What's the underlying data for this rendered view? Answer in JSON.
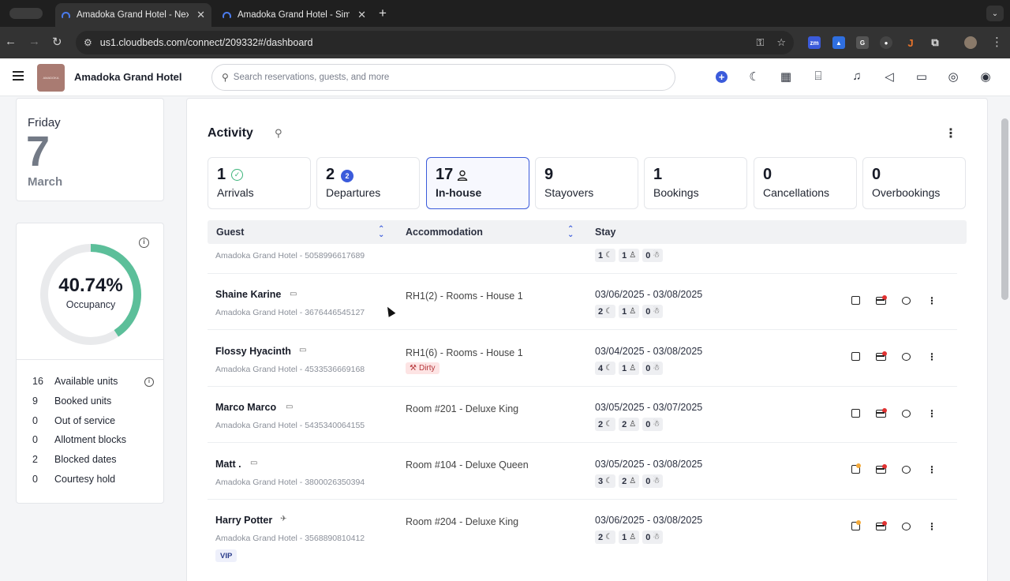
{
  "browser": {
    "tabs": [
      {
        "title": "Amadoka Grand Hotel - Next",
        "active": true
      },
      {
        "title": "Amadoka Grand Hotel - Simp",
        "active": false
      }
    ],
    "new_tab": "+",
    "url": "us1.cloudbeds.com/connect/209332#/dashboard"
  },
  "header": {
    "hotel_name": "Amadoka Grand Hotel",
    "search_placeholder": "Search reservations, guests, and more",
    "icons": [
      "add-icon",
      "moon-icon",
      "calendar-icon",
      "bed-icon",
      "bell-icon",
      "megaphone-icon",
      "inbox-icon",
      "wallet-icon",
      "user-icon"
    ]
  },
  "date_card": {
    "weekday": "Friday",
    "day": "7",
    "month": "March"
  },
  "occupancy": {
    "percent_text": "40.74%",
    "percent_value": 40.74,
    "label": "Occupancy",
    "colors": {
      "filled": "#5cbf9a",
      "track": "#e9eaec"
    },
    "stats": [
      {
        "value": "16",
        "label": "Available units"
      },
      {
        "value": "9",
        "label": "Booked units"
      },
      {
        "value": "0",
        "label": "Out of service"
      },
      {
        "value": "0",
        "label": "Allotment blocks"
      },
      {
        "value": "2",
        "label": "Blocked dates"
      },
      {
        "value": "0",
        "label": "Courtesy hold"
      }
    ]
  },
  "activity": {
    "title": "Activity",
    "tabs": [
      {
        "count": "1",
        "label": "Arrivals"
      },
      {
        "count": "2",
        "label": "Departures",
        "badge": "2"
      },
      {
        "count": "17",
        "label": "In-house"
      },
      {
        "count": "9",
        "label": "Stayovers"
      },
      {
        "count": "1",
        "label": "Bookings"
      },
      {
        "count": "0",
        "label": "Cancellations"
      },
      {
        "count": "0",
        "label": "Overbookings"
      }
    ],
    "columns": {
      "guest": "Guest",
      "accommodation": "Accommodation",
      "stay": "Stay"
    },
    "partial_row": {
      "sub": "Amadoka Grand Hotel - 5058996617689",
      "nights": "1",
      "adults": "1",
      "kids": "0"
    },
    "rows": [
      {
        "name": "Shaine Karine",
        "sub": "Amadoka Grand Hotel - 3676446545127",
        "accommodation": "RH1(2) - Rooms - House 1",
        "dates": "03/06/2025 - 03/08/2025",
        "nights": "2",
        "adults": "1",
        "kids": "0"
      },
      {
        "name": "Flossy Hyacinth",
        "sub": "Amadoka Grand Hotel - 4533536669168",
        "accommodation": "RH1(6) - Rooms - House 1",
        "dates": "03/04/2025 - 03/08/2025",
        "nights": "4",
        "adults": "1",
        "kids": "0",
        "status": "Dirty"
      },
      {
        "name": "Marco Marco",
        "sub": "Amadoka Grand Hotel - 5435340064155",
        "accommodation": "Room #201 - Deluxe King",
        "dates": "03/05/2025 - 03/07/2025",
        "nights": "2",
        "adults": "2",
        "kids": "0"
      },
      {
        "name": "Matt .",
        "sub": "Amadoka Grand Hotel - 3800026350394",
        "accommodation": "Room #104 - Deluxe Queen",
        "dates": "03/05/2025 - 03/08/2025",
        "nights": "3",
        "adults": "2",
        "kids": "0"
      },
      {
        "name": "Harry Potter",
        "sub": "Amadoka Grand Hotel - 3568890810412",
        "accommodation": "Room #204 - Deluxe King",
        "dates": "03/06/2025 - 03/08/2025",
        "nights": "2",
        "adults": "1",
        "kids": "0",
        "tag": "VIP"
      }
    ]
  }
}
